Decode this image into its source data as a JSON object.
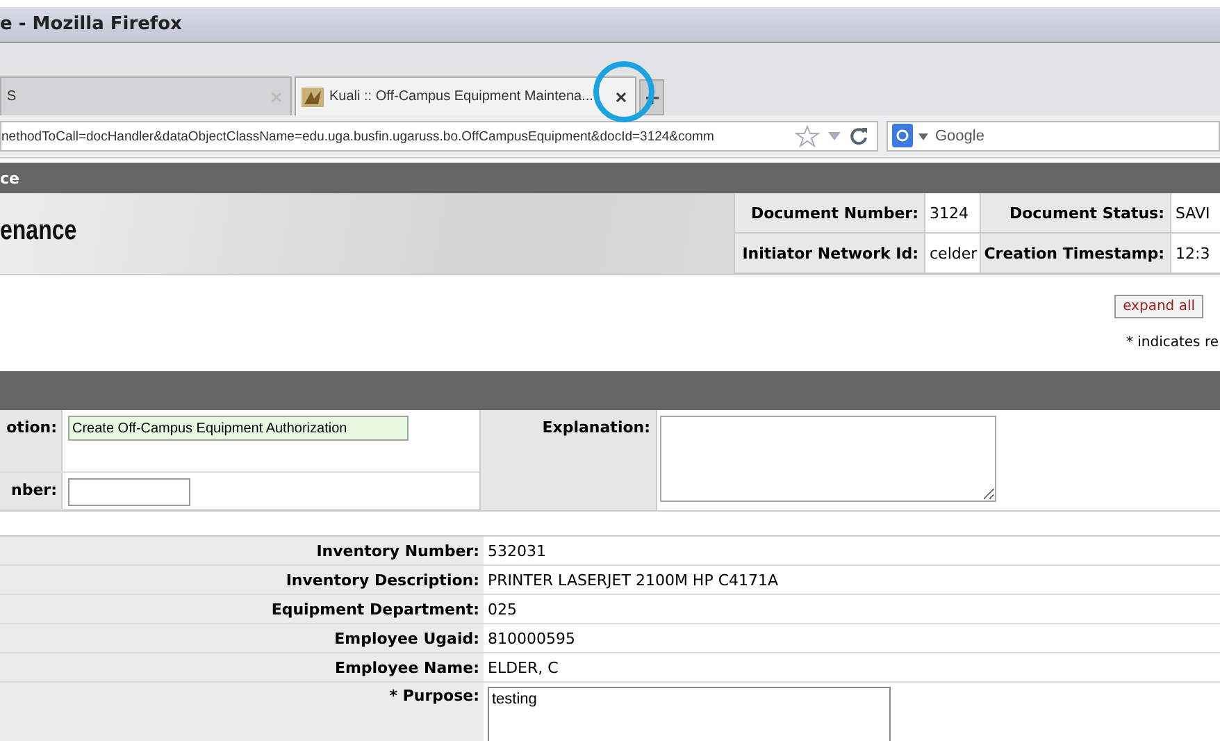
{
  "window": {
    "title": "e - Mozilla Firefox"
  },
  "tabs": [
    {
      "label": "S",
      "selected": false
    },
    {
      "label": "Kuali :: Off-Campus Equipment Maintena...",
      "selected": true
    }
  ],
  "address_bar": {
    "value": "nethodToCall=docHandler&dataObjectClassName=edu.uga.busfin.ugaruss.bo.OffCampusEquipment&docId=3124&comm"
  },
  "search": {
    "placeholder": "Google"
  },
  "page_bar": {
    "title": "ce"
  },
  "document": {
    "title": "enance",
    "info": [
      {
        "label": "Document Number:",
        "value": "3124"
      },
      {
        "label": "Document Status:",
        "value": "SAVI"
      },
      {
        "label": "Initiator Network Id:",
        "value": "celder"
      },
      {
        "label": "Creation Timestamp:",
        "value": "12:3"
      }
    ]
  },
  "expand_button": "expand all",
  "required_note": "* indicates re",
  "overview": {
    "description_label": "otion:",
    "description_value": "Create Off-Campus Equipment Authorization",
    "number_label": "nber:",
    "explanation_label": "Explanation:"
  },
  "details": [
    {
      "label": "Inventory Number:",
      "value": "532031"
    },
    {
      "label": "Inventory Description:",
      "value": "PRINTER LASERJET 2100M HP C4171A"
    },
    {
      "label": "Equipment Department:",
      "value": "025"
    },
    {
      "label": "Employee Ugaid:",
      "value": "810000595"
    },
    {
      "label": "Employee Name:",
      "value": "ELDER, C"
    }
  ],
  "purpose": {
    "label": "* Purpose:",
    "value": "testing"
  }
}
